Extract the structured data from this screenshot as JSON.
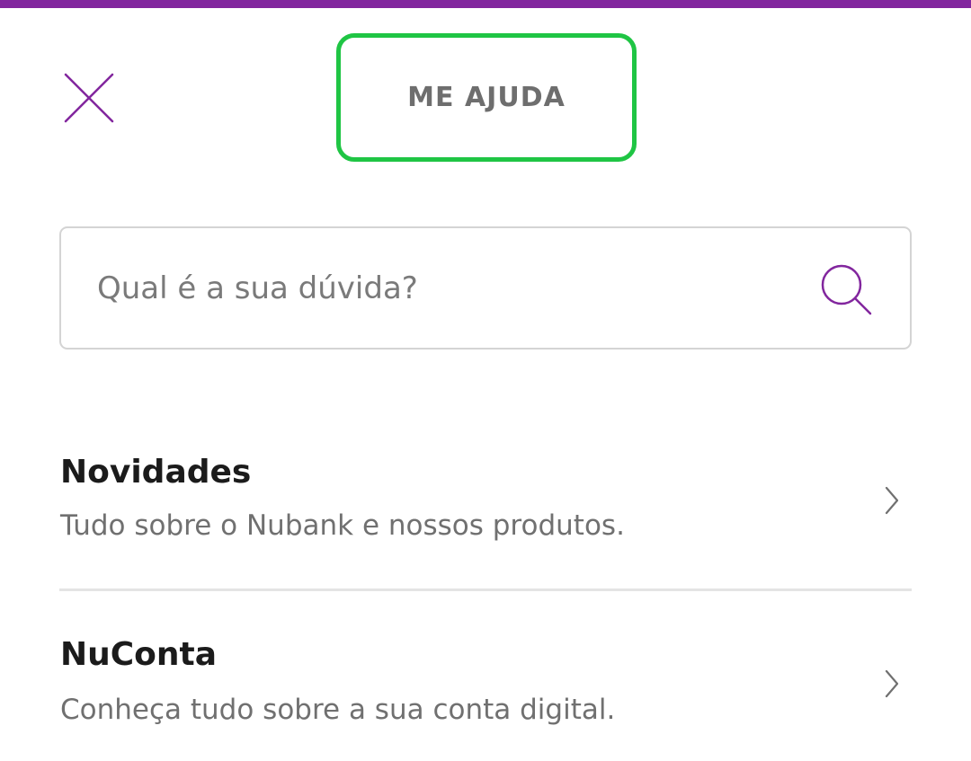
{
  "header": {
    "close_icon": "close-icon",
    "title": "ME AJUDA",
    "accent_color": "#82269e",
    "highlight_color": "#1fc544"
  },
  "search": {
    "placeholder": "Qual é a sua dúvida?",
    "value": "",
    "icon": "search-icon"
  },
  "topics": [
    {
      "title": "Novidades",
      "description": "Tudo sobre o Nubank e nossos produtos.",
      "icon": "chevron-right-icon"
    },
    {
      "title": "NuConta",
      "description": "Conheça tudo sobre a sua conta digital.",
      "icon": "chevron-right-icon"
    }
  ]
}
